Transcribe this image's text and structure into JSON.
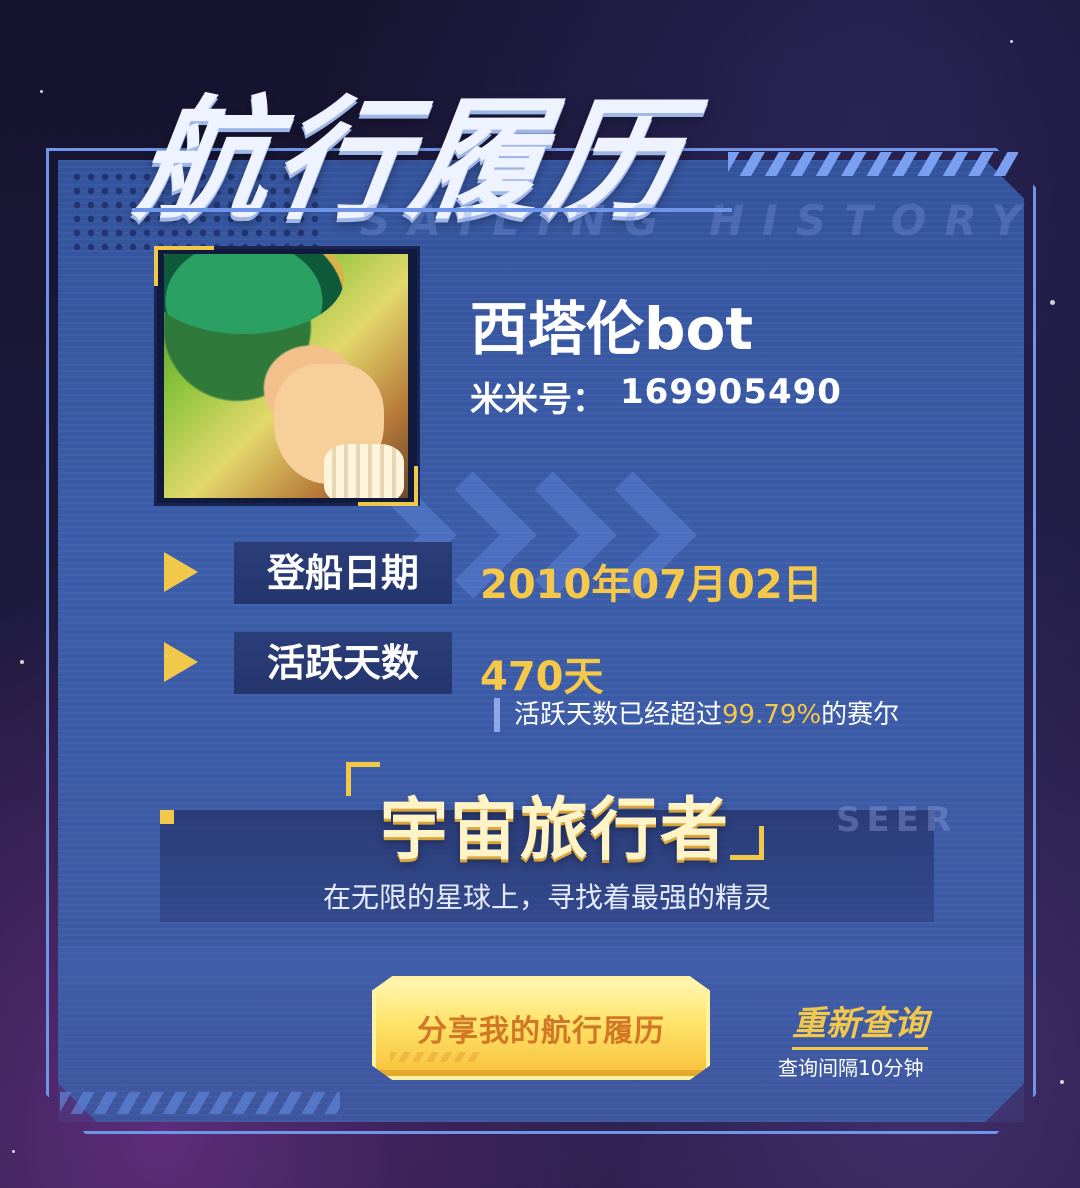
{
  "header": {
    "title": "航行履历",
    "subtitle_ghost": "SAILING HISTORY"
  },
  "profile": {
    "nickname": "西塔伦bot",
    "uid_label": "米米号：",
    "uid_value": "169905490"
  },
  "stats": {
    "board_date": {
      "label": "登船日期",
      "value": "2010年07月02日"
    },
    "active_days": {
      "label": "活跃天数",
      "value": "470天",
      "note_prefix": "活跃天数已经超过",
      "note_percent": "99.79%",
      "note_suffix": "的赛尔"
    }
  },
  "rank": {
    "title": "宇宙旅行者",
    "ghost": "SEER",
    "description": "在无限的星球上，寻找着最强的精灵"
  },
  "actions": {
    "share_label": "分享我的航行履历",
    "requery_label": "重新查询",
    "interval_note": "查询间隔10分钟"
  },
  "colors": {
    "accent_gold": "#f5c84a",
    "panel_blue": "#3b5ca8",
    "frame_blue": "#6f95e8"
  }
}
